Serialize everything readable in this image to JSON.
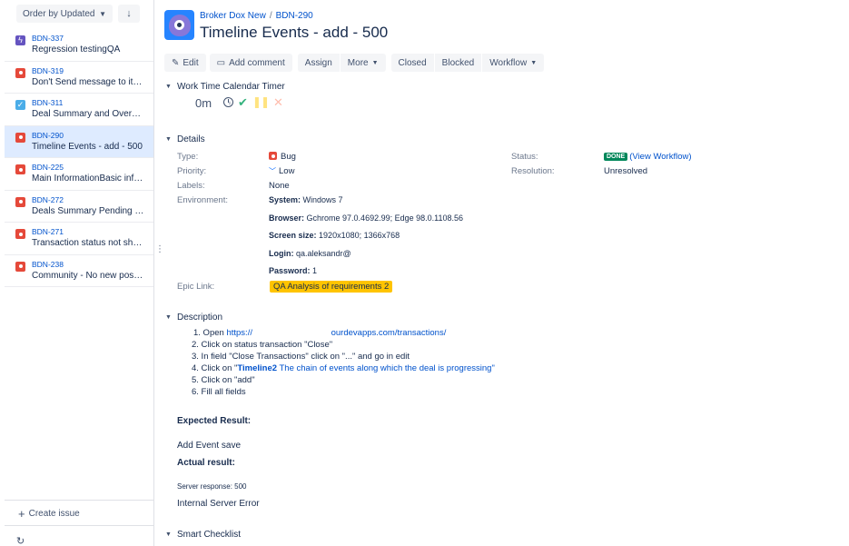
{
  "sidebar": {
    "order_label": "Order by Updated",
    "sort_icon": "arrow-down-icon",
    "issues": [
      {
        "key": "BDN-337",
        "summary": "Regression testingQA",
        "type": "story"
      },
      {
        "key": "BDN-319",
        "summary": "Don't Send message to itself",
        "type": "bug"
      },
      {
        "key": "BDN-311",
        "summary": "Deal Summary and Overvie...",
        "type": "task"
      },
      {
        "key": "BDN-290",
        "summary": "Timeline Events - add - 500",
        "type": "bug",
        "selected": true
      },
      {
        "key": "BDN-225",
        "summary": "Main InformationBasic infor...",
        "type": "bug"
      },
      {
        "key": "BDN-272",
        "summary": "Deals Summary Pending 0 -...",
        "type": "bug"
      },
      {
        "key": "BDN-271",
        "summary": "Transaction status not show...",
        "type": "bug"
      },
      {
        "key": "BDN-238",
        "summary": "Community - No new posts ...",
        "type": "bug"
      }
    ],
    "create_issue_label": "Create issue"
  },
  "header": {
    "project_name": "Broker Dox New",
    "breadcrumb_sep": "/",
    "issue_key": "BDN-290",
    "title": "Timeline Events - add - 500"
  },
  "toolbar": {
    "edit": "Edit",
    "add_comment": "Add comment",
    "assign": "Assign",
    "more": "More",
    "closed": "Closed",
    "blocked": "Blocked",
    "workflow": "Workflow"
  },
  "timer": {
    "section_title": "Work Time Calendar Timer",
    "value": "0m"
  },
  "details": {
    "section_title": "Details",
    "type_label": "Type:",
    "type_value": "Bug",
    "priority_label": "Priority:",
    "priority_value": "Low",
    "labels_label": "Labels:",
    "labels_value": "None",
    "environment_label": "Environment:",
    "env": {
      "system_label": "System:",
      "system_value": "Windows 7",
      "browser_label": "Browser:",
      "browser_value": "Gchrome 97.0.4692.99; Edge 98.0.1108.56",
      "screen_label": "Screen size:",
      "screen_value": "1920x1080; 1366x768",
      "login_label": "Login:",
      "login_value": "qa.aleksandr@",
      "password_label": "Password:",
      "password_value": "1"
    },
    "epic_label": "Epic Link:",
    "epic_value": "QA Analysis of requirements 2",
    "status_label": "Status:",
    "status_badge": "DONE",
    "status_link": "(View Workflow)",
    "resolution_label": "Resolution:",
    "resolution_value": "Unresolved"
  },
  "description": {
    "section_title": "Description",
    "step1_prefix": "1.  Open",
    "step1_link_a": "https://",
    "step1_link_b": "ourdevapps.com/transactions/",
    "step2": "2. Click on status transaction \"Close\"",
    "step3": "3. In field \"Close Transactions\" click on \"...\" and go in edit",
    "step4_prefix": "4. Click on \"",
    "step4_bold": "Timeline2",
    "step4_rest": " The chain of events along which the deal is progressing\"",
    "step5": "5. Click on \"add\"",
    "step6": "6. Fill all fields",
    "expected_label": "Expected Result:",
    "expected_value": "Add Event save",
    "actual_label": "Actual result:",
    "server_response": "Server response: 500",
    "error_text": "Internal Server Error"
  },
  "smart_checklist": {
    "section_title": "Smart Checklist"
  },
  "colors": {
    "link": "#0052cc",
    "done": "#00875a",
    "epic": "#ffc400",
    "bug": "#e5493a",
    "story": "#6554c0",
    "task": "#4bade8"
  }
}
